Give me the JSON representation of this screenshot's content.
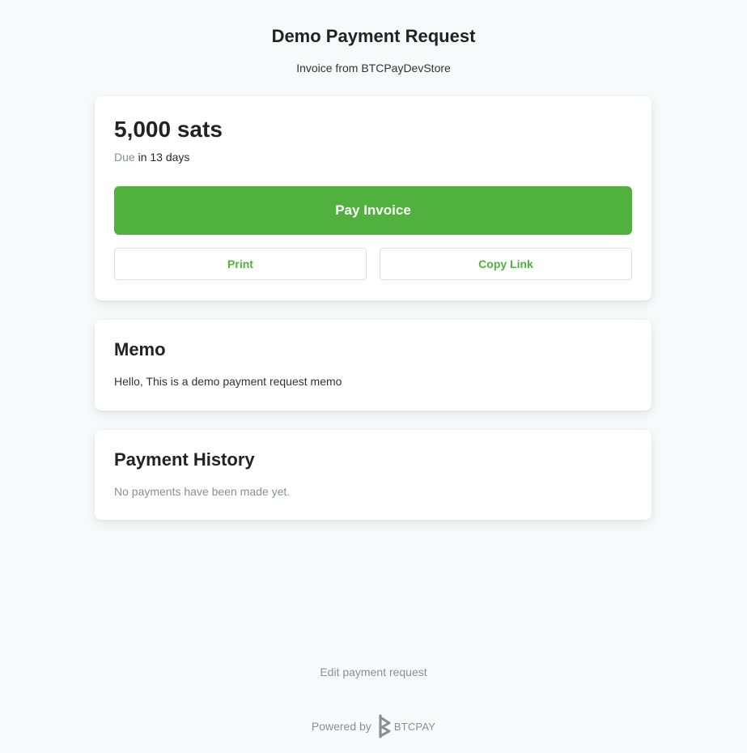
{
  "header": {
    "title": "Demo Payment Request",
    "subtitle": "Invoice from BTCPayDevStore"
  },
  "amount_card": {
    "amount": "5,000 sats",
    "due_label": "Due",
    "due_value": "in 13 days",
    "pay_button": "Pay Invoice",
    "print_button": "Print",
    "copy_link_button": "Copy Link"
  },
  "memo": {
    "title": "Memo",
    "text": "Hello, This is a demo payment request memo"
  },
  "history": {
    "title": "Payment History",
    "empty_text": "No payments have been made yet."
  },
  "footer": {
    "edit_link": "Edit payment request",
    "powered_by": "Powered by",
    "brand": "BTCPAY",
    "brand_icon": "btcpay-logo-icon"
  },
  "colors": {
    "accent": "#51b13e",
    "muted_text": "#8a8f95",
    "background": "#f8f9fa"
  }
}
